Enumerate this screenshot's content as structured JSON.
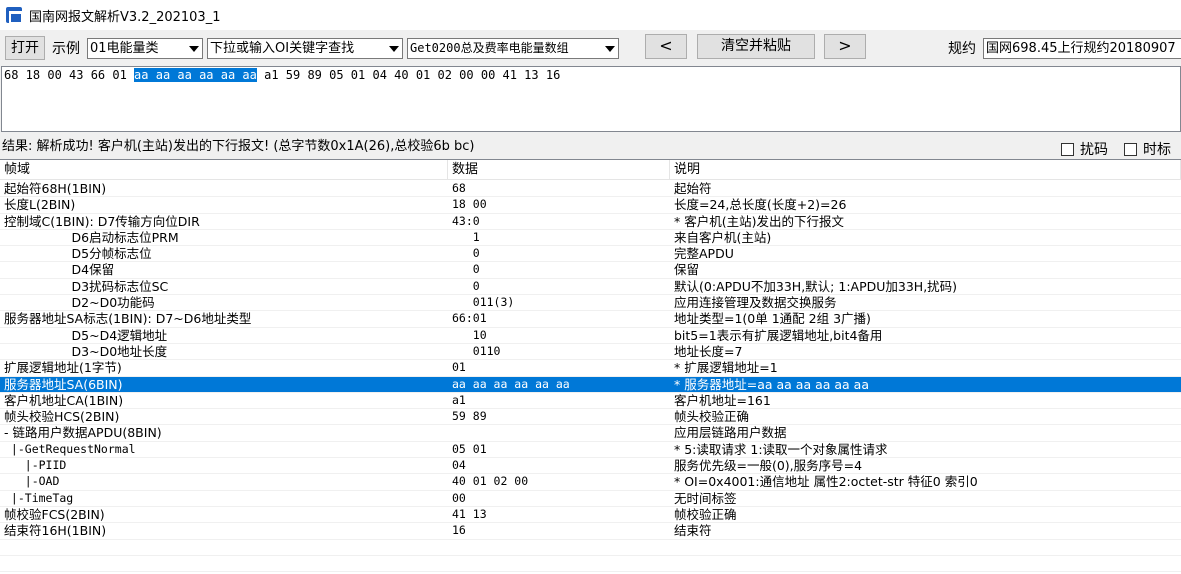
{
  "window": {
    "title": "国南网报文解析V3.2_202103_1"
  },
  "toolbar": {
    "open_label": "打开",
    "example_label": "示例",
    "example_value": "01电能量类",
    "search_value": "下拉或输入OI关键字查找",
    "item_value": "Get0200总及费率电能量数组",
    "prev_label": "<",
    "clear_label": "清空并粘贴",
    "next_label": ">",
    "rule_label": "规约",
    "rule_value": "国网698.45上行规约20180907"
  },
  "hex": {
    "before": "68 18 00 43 66 01 ",
    "selected": "aa aa aa aa aa aa",
    "after": " a1 59 89 05 01 04 40 01 02 00 00 41 13 16"
  },
  "result": {
    "text": "结果: 解析成功! 客户机(主站)发出的下行报文! (总字节数0x1A(26),总校验6b bc)",
    "scramble_label": "扰码",
    "scramble_checked": false,
    "timetag_label": "时标",
    "timetag_checked": false
  },
  "grid": {
    "headers": [
      "帧域",
      "数据",
      "说明"
    ],
    "selected_index": 12,
    "rows": [
      [
        "起始符68H(1BIN)",
        "68",
        "起始符"
      ],
      [
        "长度L(2BIN)",
        "18 00",
        "长度=24,总长度(长度+2)=26"
      ],
      [
        "控制域C(1BIN): D7传输方向位DIR",
        "43:0",
        "* 客户机(主站)发出的下行报文"
      ],
      [
        "                 D6启动标志位PRM",
        "   1",
        "来自客户机(主站)"
      ],
      [
        "                 D5分帧标志位",
        "   0",
        "完整APDU"
      ],
      [
        "                 D4保留",
        "   0",
        "保留"
      ],
      [
        "                 D3扰码标志位SC",
        "   0",
        "默认(0:APDU不加33H,默认; 1:APDU加33H,扰码)"
      ],
      [
        "                 D2~D0功能码",
        "   011(3)",
        "应用连接管理及数据交换服务"
      ],
      [
        "服务器地址SA标志(1BIN): D7~D6地址类型",
        "66:01",
        "地址类型=1(0单 1通配 2组 3广播)"
      ],
      [
        "                 D5~D4逻辑地址",
        "   10",
        "bit5=1表示有扩展逻辑地址,bit4备用"
      ],
      [
        "                 D3~D0地址长度",
        "   0110",
        "地址长度=7"
      ],
      [
        "扩展逻辑地址(1字节)",
        "01",
        "* 扩展逻辑地址=1"
      ],
      [
        "服务器地址SA(6BIN)",
        "aa aa aa aa aa aa",
        "* 服务器地址=aa aa aa aa aa aa"
      ],
      [
        "客户机地址CA(1BIN)",
        "a1",
        "客户机地址=161"
      ],
      [
        "帧头校验HCS(2BIN)",
        "59 89",
        "帧头校验正确"
      ],
      [
        "- 链路用户数据APDU(8BIN)",
        "",
        "应用层链路用户数据"
      ],
      [
        " |-GetRequestNormal",
        "05 01",
        "* 5:读取请求 1:读取一个对象属性请求"
      ],
      [
        "   |-PIID",
        "04",
        "服务优先级=一般(0),服务序号=4"
      ],
      [
        "   |-OAD",
        "40 01 02 00",
        "* OI=0x4001:通信地址 属性2:octet-str 特征0 索引0"
      ],
      [
        " |-TimeTag",
        "00",
        "无时间标签"
      ],
      [
        "帧校验FCS(2BIN)",
        "41 13",
        "帧校验正确"
      ],
      [
        "结束符16H(1BIN)",
        "16",
        "结束符"
      ],
      [
        "",
        "",
        ""
      ],
      [
        "",
        "",
        ""
      ]
    ]
  }
}
